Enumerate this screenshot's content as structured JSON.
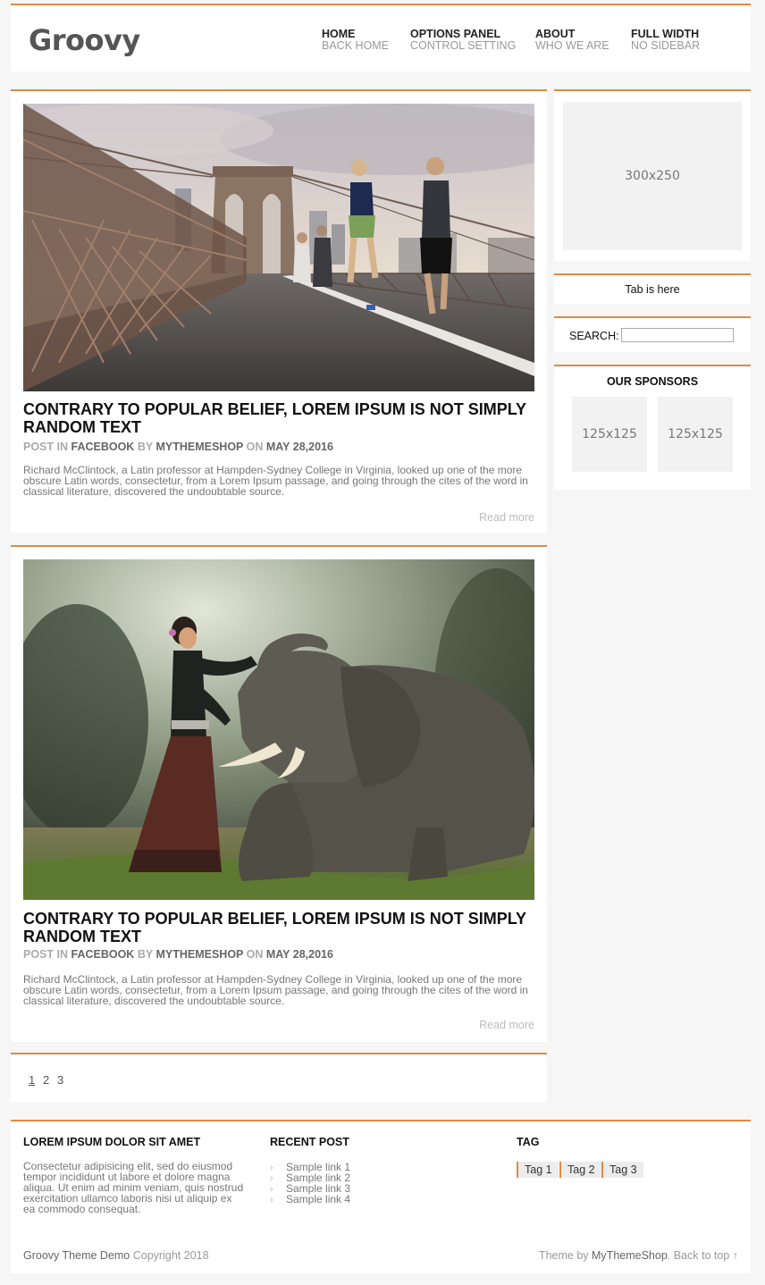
{
  "header": {
    "logo": "Groovy",
    "nav": [
      {
        "title": "HOME",
        "subtitle": "BACK HOME"
      },
      {
        "title": "OPTIONS PANEL",
        "subtitle": "CONTROL SETTING"
      },
      {
        "title": "ABOUT",
        "subtitle": "WHO WE ARE"
      },
      {
        "title": "FULL WIDTH",
        "subtitle": "NO SIDEBAR"
      }
    ]
  },
  "posts": [
    {
      "title": "CONTRARY TO POPULAR BELIEF, LOREM IPSUM IS NOT SIMPLY RANDOM TEXT",
      "meta_post_in": "POST IN",
      "category": "FACEBOOK",
      "meta_by": "BY",
      "author": "MYTHEMESHOP",
      "meta_on": "ON",
      "date": "MAY 28,2016",
      "excerpt": "Richard McClintock, a Latin professor at Hampden-Sydney College in Virginia, looked up one of the more obscure Latin words, consectetur, from a Lorem Ipsum passage, and going through the cites of the word in classical literature, discovered the undoubtable source.",
      "read_more": "Read more"
    },
    {
      "title": "CONTRARY TO POPULAR BELIEF, LOREM IPSUM IS NOT SIMPLY RANDOM TEXT",
      "meta_post_in": "POST IN",
      "category": "FACEBOOK",
      "meta_by": "BY",
      "author": "MYTHEMESHOP",
      "meta_on": "ON",
      "date": "MAY 28,2016",
      "excerpt": "Richard McClintock, a Latin professor at Hampden-Sydney College in Virginia, looked up one of the more obscure Latin words, consectetur, from a Lorem Ipsum passage, and going through the cites of the word in classical literature, discovered the undoubtable source.",
      "read_more": "Read more"
    }
  ],
  "pagination": {
    "pages": [
      "1",
      "2",
      "3"
    ],
    "current": "1"
  },
  "sidebar": {
    "ad": "300x250",
    "tab": "Tab is here",
    "search_label": "SEARCH:",
    "search_value": "",
    "sponsors_title": "OUR SPONSORS",
    "sponsors": [
      "125x125",
      "125x125"
    ]
  },
  "footer": {
    "col1_title": "LOREM IPSUM DOLOR SIT AMET",
    "col1_text": "Consectetur adipisicing elit, sed do eiusmod tempor incididunt ut labore et dolore magna aliqua. Ut enim ad minim veniam, quis nostrud exercitation ullamco laboris nisi ut aliquip ex ea commodo consequat.",
    "col2_title": "RECENT POST",
    "recent": [
      "Sample link 1",
      "Sample link 2",
      "Sample link 3",
      "Sample link 4"
    ],
    "col3_title": "TAG",
    "tags": [
      "Tag 1",
      "Tag 2",
      "Tag 3"
    ],
    "copyright_brand": "Groovy Theme Demo",
    "copyright_text": "Copyright 2018",
    "credit_prefix": "Theme by",
    "credit_brand": "MyThemeShop",
    "back_to_top": ". Back to top ↑"
  },
  "colors": {
    "accent": "#e08a43",
    "background": "#f6f6f6"
  }
}
